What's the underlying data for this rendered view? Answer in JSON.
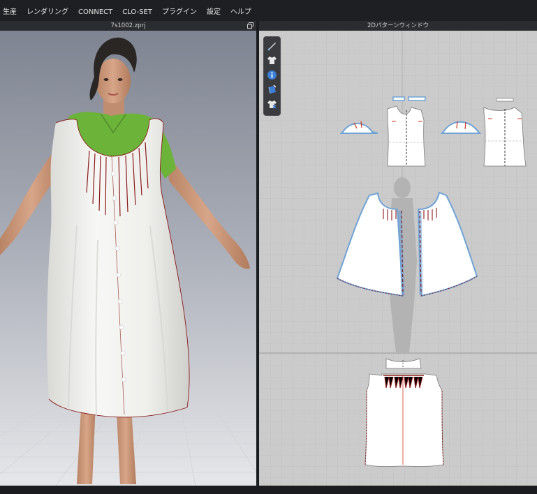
{
  "menubar": {
    "items": [
      "生産",
      "レンダリング",
      "CONNECT",
      "CLO-SET",
      "プラグイン",
      "設定",
      "ヘルプ"
    ]
  },
  "view3d": {
    "title": "7s1002.zprj"
  },
  "view2d": {
    "title": "2Dパターンウィンドウ"
  },
  "toolbar": {
    "tools": [
      "brush-icon",
      "shirt-icon",
      "info-icon",
      "fabric-icon",
      "avatar-shirt-icon"
    ]
  },
  "colors": {
    "menubar": "#1e1f22",
    "workspace": "#c9c9c9",
    "grid": "#b9b9b9",
    "pattern_fill": "#ffffff",
    "selected_outline": "#6fa3d6",
    "seam": "#8a1a1a",
    "tshirt": "#6cb33a",
    "dress": "#f1f1ef"
  }
}
